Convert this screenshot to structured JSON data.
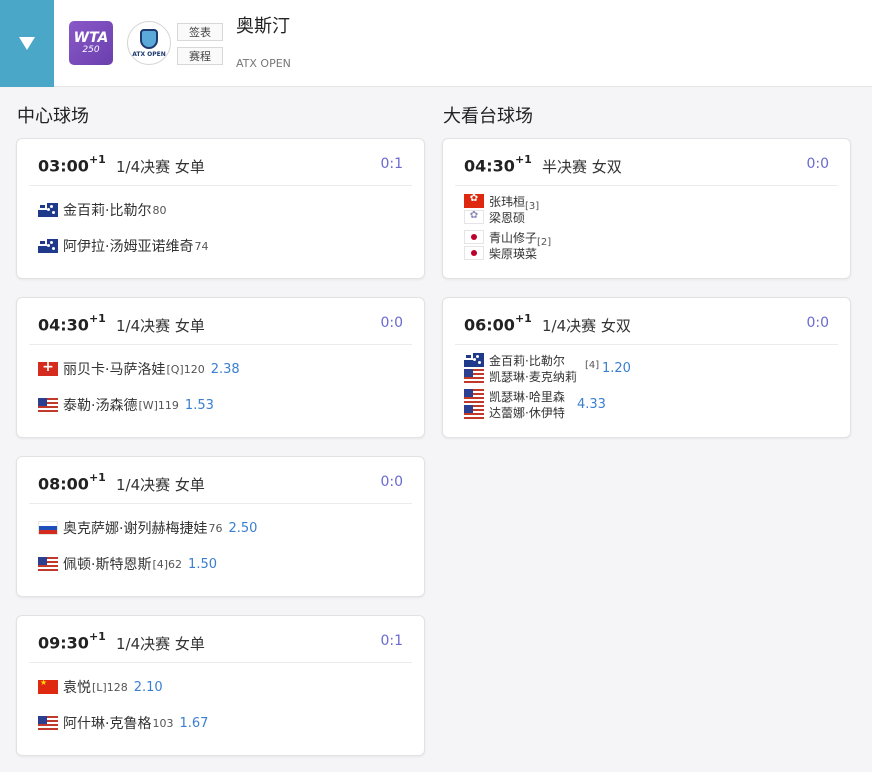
{
  "header": {
    "toggle_icon": "triangle-down",
    "wta_logo": [
      "WTA",
      "250"
    ],
    "tournament_logo_text": "ATX OPEN",
    "buttons": [
      "签表",
      "赛程"
    ],
    "title": "奥斯汀",
    "subtitle": "ATX OPEN"
  },
  "columns": [
    {
      "name": "中心球场",
      "matches": [
        {
          "time": "03:00",
          "day_offset": "+1",
          "round": "1/4决赛 女单",
          "score": "0:1",
          "players": [
            {
              "flag": "aus",
              "name": "金百莉·比勒尔",
              "seed": "80",
              "odds": ""
            },
            {
              "flag": "aus",
              "name": "阿伊拉·汤姆亚诺维奇",
              "seed": "74",
              "odds": ""
            }
          ]
        },
        {
          "time": "04:30",
          "day_offset": "+1",
          "round": "1/4决赛 女单",
          "score": "0:0",
          "players": [
            {
              "flag": "sui",
              "name": "丽贝卡·马萨洛娃",
              "seed": "[Q]120",
              "odds": "2.38"
            },
            {
              "flag": "usa",
              "name": "泰勒·汤森德",
              "seed": "[W]119",
              "odds": "1.53"
            }
          ]
        },
        {
          "time": "08:00",
          "day_offset": "+1",
          "round": "1/4决赛 女单",
          "score": "0:0",
          "players": [
            {
              "flag": "rus",
              "name": "奥克萨娜·谢列赫梅捷娃",
              "seed": "76",
              "odds": "2.50"
            },
            {
              "flag": "usa",
              "name": "佩顿·斯特恩斯",
              "seed": "[4]62",
              "odds": "1.50"
            }
          ]
        },
        {
          "time": "09:30",
          "day_offset": "+1",
          "round": "1/4决赛 女单",
          "score": "0:1",
          "players": [
            {
              "flag": "chn",
              "name": "袁悦",
              "seed": "[L]128",
              "odds": "2.10"
            },
            {
              "flag": "usa",
              "name": "阿什琳·克鲁格",
              "seed": "103",
              "odds": "1.67"
            }
          ]
        }
      ]
    },
    {
      "name": "大看台球场",
      "matches": [
        {
          "time": "04:30",
          "day_offset": "+1",
          "round": "半决赛 女双",
          "score": "0:0",
          "teams": [
            {
              "players": [
                {
                  "flag": "hkg",
                  "name": "张玮桓"
                },
                {
                  "flag": "tpe",
                  "name": "梁恩硕"
                }
              ],
              "seed": "[3]",
              "odds": ""
            },
            {
              "players": [
                {
                  "flag": "jpn",
                  "name": "青山修子"
                },
                {
                  "flag": "jpn",
                  "name": "柴原瑛菜"
                }
              ],
              "seed": "[2]",
              "odds": ""
            }
          ]
        },
        {
          "time": "06:00",
          "day_offset": "+1",
          "round": "1/4决赛 女双",
          "score": "0:0",
          "teams": [
            {
              "players": [
                {
                  "flag": "aus",
                  "name": "金百莉·比勒尔"
                },
                {
                  "flag": "usa",
                  "name": "凯瑟琳·麦克纳莉"
                }
              ],
              "seed": "[4]",
              "odds": "1.20"
            },
            {
              "players": [
                {
                  "flag": "usa",
                  "name": "凯瑟琳·哈里森"
                },
                {
                  "flag": "usa",
                  "name": "达蕾娜·休伊特"
                }
              ],
              "seed": "",
              "odds": "4.33"
            }
          ]
        }
      ]
    }
  ],
  "colors": {
    "accent": "#4aa7c7",
    "score": "#6a6ad0",
    "odds": "#3a7fcf",
    "wta": "#7a4cc0"
  }
}
